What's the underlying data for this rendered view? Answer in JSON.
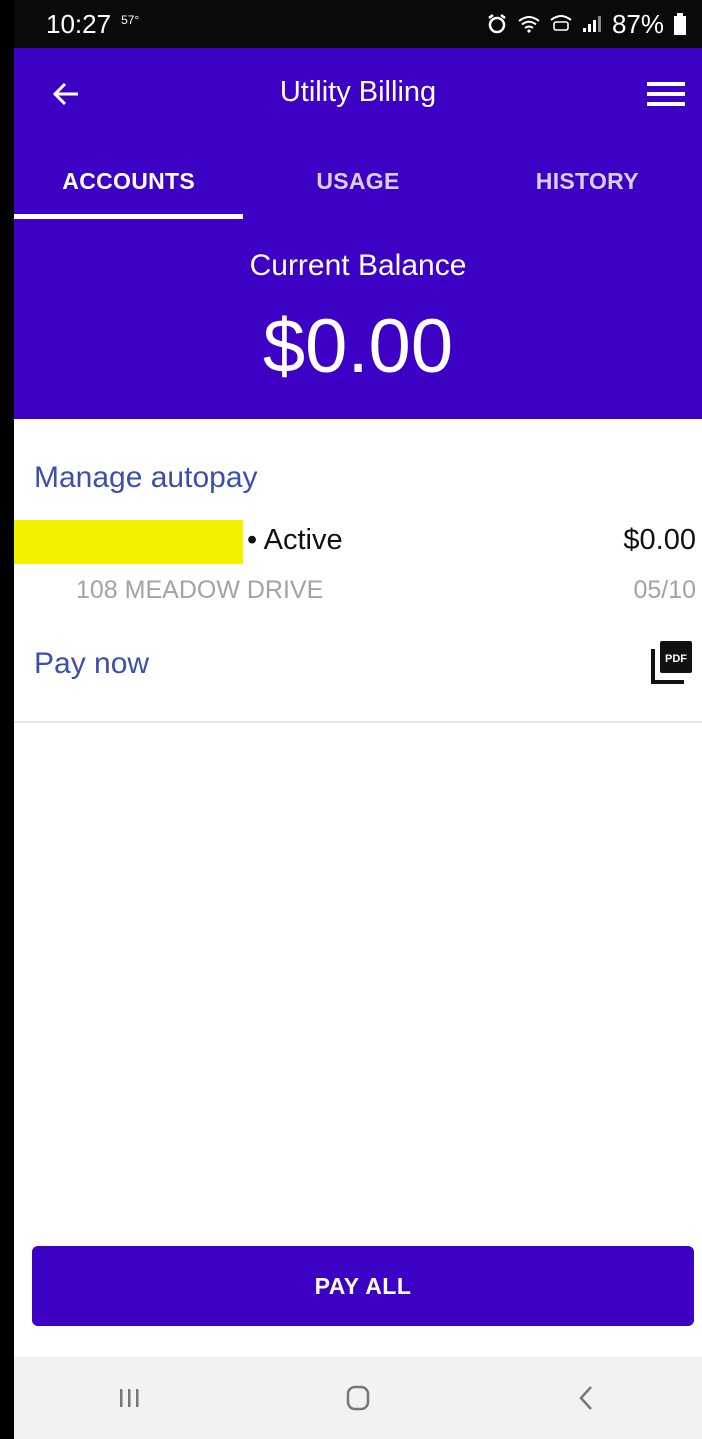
{
  "status_bar": {
    "time": "10:27",
    "temperature": "57°",
    "battery": "87%",
    "icons": [
      "alarm-icon",
      "wifi-icon",
      "wifi-calling-icon",
      "signal-icon",
      "battery-icon"
    ]
  },
  "app_bar": {
    "title": "Utility Billing",
    "left_icon": "back-arrow-icon",
    "right_icon": "hamburger-menu-icon"
  },
  "tabs": [
    {
      "label": "ACCOUNTS",
      "active": true
    },
    {
      "label": "USAGE",
      "active": false
    },
    {
      "label": "HISTORY",
      "active": false
    }
  ],
  "balance": {
    "label": "Current Balance",
    "amount": "$0.00"
  },
  "account": {
    "manage_autopay_label": "Manage autopay",
    "status": "• Active",
    "amount": "$0.00",
    "address": "108 MEADOW DRIVE",
    "due_date": "05/10",
    "pay_now_label": "Pay now",
    "pdf_icon": "pdf-icon",
    "pdf_label": "PDF"
  },
  "pay_all_label": "PAY ALL",
  "nav_bar": {
    "icons": [
      "recent-apps-icon",
      "home-icon",
      "back-icon"
    ]
  },
  "colors": {
    "primary": "#3d00c5",
    "link": "#3a4fae",
    "redaction": "#f3f000",
    "secondary_text": "#a3a3a3"
  }
}
